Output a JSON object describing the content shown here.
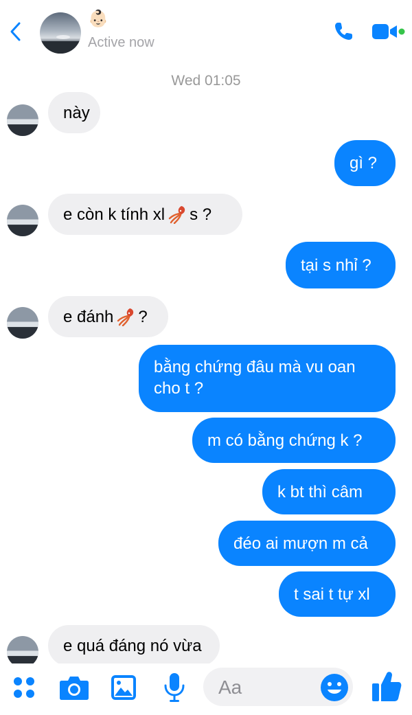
{
  "header": {
    "status": "Active now",
    "face_emoji": "👶🏻"
  },
  "timestamp": "Wed 01:05",
  "messages": [
    {
      "side": "in",
      "text": "này"
    },
    {
      "side": "out",
      "text": "gì ?"
    },
    {
      "side": "in",
      "before": "e còn k tính xl",
      "emoji": "squid",
      "after": "s ?"
    },
    {
      "side": "out",
      "text": "tại s nhỉ ?"
    },
    {
      "side": "in",
      "before": "e đánh",
      "emoji": "squid",
      "after": "?"
    },
    {
      "side": "out",
      "text": "bằng chứng đâu mà vu oan cho t ?"
    },
    {
      "side": "out",
      "text": "m có bằng chứng k ?"
    },
    {
      "side": "out",
      "text": "k bt thì câm"
    },
    {
      "side": "out",
      "text": "đéo ai mượn m cả"
    },
    {
      "side": "out",
      "text": "t sai t tự xl"
    },
    {
      "side": "in",
      "text": "e quá đáng nó vừa"
    }
  ],
  "composer": {
    "placeholder": "Aa"
  },
  "colors": {
    "accent": "#0a84ff",
    "incoming_bubble": "#efeff1",
    "muted_text": "#999999"
  }
}
